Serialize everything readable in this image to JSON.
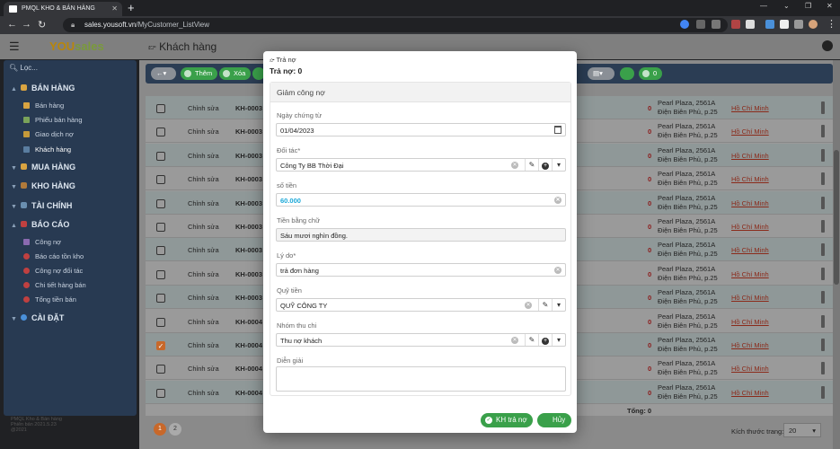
{
  "browser": {
    "tab_title": "PMQL KHO & BÁN HÀNG",
    "url_host": "sales.yousoft.vn",
    "url_path": "/MyCustomer_ListView"
  },
  "app": {
    "brand_you": "YOU",
    "brand_sales": "sales",
    "page_title": "Khách hàng",
    "footer_line1": "PMQL Kho & Bán hàng",
    "footer_line2": "Phiên bản 2021.5.23",
    "footer_line3": "@2021"
  },
  "sidebar": {
    "search_placeholder": "Lọc...",
    "groups": [
      {
        "label": "BÁN HÀNG",
        "items": [
          "Bán hàng",
          "Phiếu bán hàng",
          "Giao dịch nợ",
          "Khách hàng"
        ]
      },
      {
        "label": "MUA HÀNG"
      },
      {
        "label": "KHO HÀNG"
      },
      {
        "label": "TÀI CHÍNH"
      },
      {
        "label": "BÁO CÁO",
        "items": [
          "Công nợ",
          "Báo cáo tồn kho",
          "Công nợ đối tác",
          "Chi tiết hàng bán",
          "Tổng tiền bán"
        ]
      },
      {
        "label": "CÀI ĐẶT"
      }
    ]
  },
  "toolbar": {
    "add_label": "Thêm",
    "delete_label": "Xóa",
    "count_label": "0"
  },
  "grid": {
    "edit_label": "Chỉnh sửa",
    "rows": [
      {
        "code": "KH-0003",
        "zero": "0",
        "addr1": "Pearl Plaza, 2561A",
        "addr2": "Điện Biên Phủ, p.25",
        "city": "Hồ Chí Minh"
      },
      {
        "code": "KH-0003",
        "zero": "0",
        "addr1": "Pearl Plaza, 2561A",
        "addr2": "Điện Biên Phủ, p.25",
        "city": "Hồ Chí Minh"
      },
      {
        "code": "KH-0003",
        "zero": "0",
        "addr1": "Pearl Plaza, 2561A",
        "addr2": "Điện Biên Phủ, p.25",
        "city": "Hồ Chí Minh"
      },
      {
        "code": "KH-0003",
        "zero": "0",
        "addr1": "Pearl Plaza, 2561A",
        "addr2": "Điện Biên Phủ, p.25",
        "city": "Hồ Chí Minh"
      },
      {
        "code": "KH-0003",
        "zero": "0",
        "addr1": "Pearl Plaza, 2561A",
        "addr2": "Điện Biên Phủ, p.25",
        "city": "Hồ Chí Minh"
      },
      {
        "code": "KH-0003",
        "zero": "0",
        "addr1": "Pearl Plaza, 2561A",
        "addr2": "Điện Biên Phủ, p.25",
        "city": "Hồ Chí Minh"
      },
      {
        "code": "KH-0003",
        "zero": "0",
        "addr1": "Pearl Plaza, 2561A",
        "addr2": "Điện Biên Phủ, p.25",
        "city": "Hồ Chí Minh"
      },
      {
        "code": "KH-0003",
        "zero": "0",
        "addr1": "Pearl Plaza, 2561A",
        "addr2": "Điện Biên Phủ, p.25",
        "city": "Hồ Chí Minh"
      },
      {
        "code": "KH-0003",
        "zero": "0",
        "addr1": "Pearl Plaza, 2561A",
        "addr2": "Điện Biên Phủ, p.25",
        "city": "Hồ Chí Minh"
      },
      {
        "code": "KH-0004",
        "zero": "0",
        "addr1": "Pearl Plaza, 2561A",
        "addr2": "Điện Biên Phủ, p.25",
        "city": "Hồ Chí Minh"
      },
      {
        "code": "KH-0004",
        "zero": "0",
        "addr1": "Pearl Plaza, 2561A",
        "addr2": "Điện Biên Phủ, p.25",
        "city": "Hồ Chí Minh",
        "checked": true
      },
      {
        "code": "KH-0004",
        "zero": "0",
        "addr1": "Pearl Plaza, 2561A",
        "addr2": "Điện Biên Phủ, p.25",
        "city": "Hồ Chí Minh"
      },
      {
        "code": "KH-0004",
        "zero": "0",
        "addr1": "Pearl Plaza, 2561A",
        "addr2": "Điện Biên Phủ, p.25",
        "city": "Hồ Chí Minh"
      }
    ],
    "total_label": "Tổng: 0",
    "pages": [
      "1",
      "2"
    ],
    "page_size_label": "Kích thước trang:",
    "page_size_value": "20"
  },
  "modal": {
    "title": "Trả nợ",
    "subtitle": "Trả nợ: 0",
    "panel_title": "Giảm công nợ",
    "fields": {
      "date_label": "Ngày chứng từ",
      "date_value": "01/04/2023",
      "partner_label": "Đối tác*",
      "partner_value": "Công Ty BB Thời Đại",
      "amount_label": "số tiền",
      "amount_value": "60.000",
      "words_label": "Tiền bằng chữ",
      "words_value": "Sáu mươi nghìn đồng.",
      "reason_label": "Lý do*",
      "reason_value": "trả đơn hàng",
      "fund_label": "Quỹ tiền",
      "fund_value": "QUỸ CÔNG TY",
      "group_label": "Nhóm thu chi",
      "group_value": "Thu nợ khách",
      "note_label": "Diễn giải"
    },
    "save_label": "KH trả nợ",
    "cancel_label": "Hủy"
  },
  "colors": {
    "accent_green": "#3aa04a",
    "sidebar_bg": "#283a52",
    "money_blue": "#1ba8d8"
  }
}
